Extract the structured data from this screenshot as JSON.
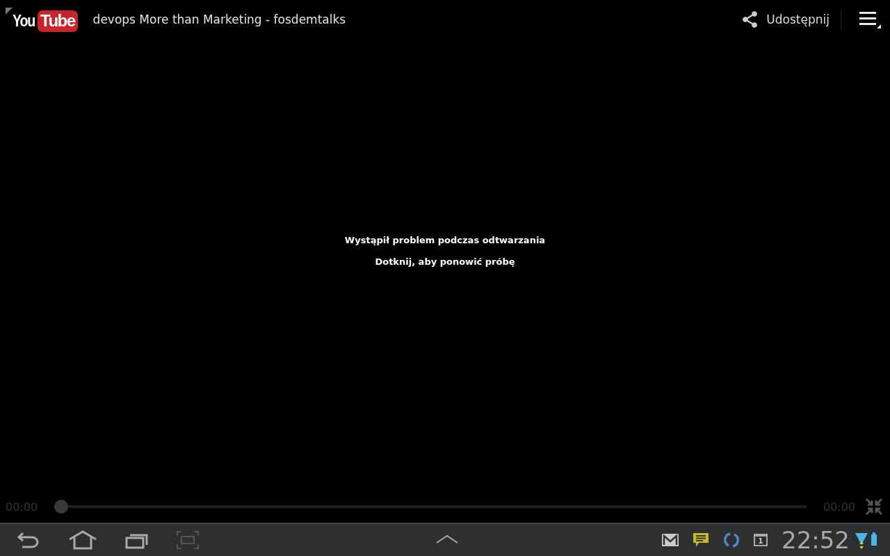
{
  "action_bar": {
    "logo": {
      "you": "You",
      "tube": "Tube"
    },
    "title": "devops More than Marketing - fosdemtalks",
    "share_label": "Udostępnij"
  },
  "player": {
    "error": "Wystąpił problem podczas odtwarzania",
    "hint": "Dotknij, aby ponowić próbę",
    "elapsed": "00:00",
    "duration": "00:00",
    "level": 0
  },
  "system_bar": {
    "calendar_day": "1",
    "clock": "22:52"
  }
}
